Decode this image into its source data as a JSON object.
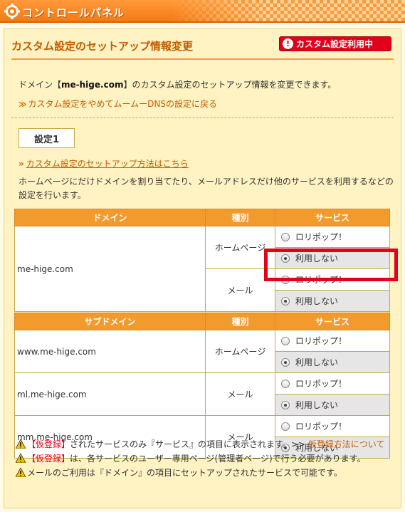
{
  "header": {
    "title": "コントロールパネル",
    "icon": "gear-icon"
  },
  "panel": {
    "title": "カスタム設定のセットアップ情報変更",
    "badge": "カスタム設定利用中",
    "badge_icon": "exclamation-icon",
    "description_prefix": "ドメイン【",
    "domain": "me-hige.com",
    "description_suffix": "】のカスタム設定のセットアップ情報を変更できます。",
    "back_link": "カスタム設定をやめてムームーDNSの設定に戻る",
    "setting_label": "設定1",
    "howto_link": "カスタム設定のセットアップ方法はこちら",
    "explain": "ホームページにだけドメインを割り当てたり、メールアドレスだけ他のサービスを利用するなどの設定を行います。"
  },
  "table1": {
    "headers": [
      "ドメイン",
      "種別",
      "サービス"
    ],
    "domain": "me-hige.com",
    "rows": [
      {
        "type": "ホームページ",
        "opt1": "ロリポップ！",
        "opt2": "利用しない"
      },
      {
        "type": "メール",
        "opt1": "ロリポップ！",
        "opt2": "利用しない"
      }
    ]
  },
  "table2": {
    "headers": [
      "サブドメイン",
      "種別",
      "サービス"
    ],
    "rows": [
      {
        "domain": "www.me-hige.com",
        "type": "ホームページ",
        "opt1": "ロリポップ！",
        "opt2": "利用しない"
      },
      {
        "domain": "ml.me-hige.com",
        "type": "メール",
        "opt1": "ロリポップ！",
        "opt2": "利用しない"
      },
      {
        "domain": "mm.me-hige.com",
        "type": "メール",
        "opt1": "ロリポップ！",
        "opt2": "利用しない"
      }
    ]
  },
  "notes": {
    "n1_red": "【仮登録】",
    "n1_text": "されたサービスのみ『サービス』の項目に表示されます。>>",
    "n1_link": "仮登録方法について",
    "n2_red": "【仮登録】",
    "n2_text": "は、各サービスのユーザー専用ページ(管理者ページ)で行う必要があります。",
    "n3_text": "メールのご利用は『ドメイン』の項目にセットアップされたサービスで可能です。"
  },
  "colors": {
    "accent": "#f39a2c",
    "highlight": "#e3001b",
    "panel_bg": "#fff3c4"
  }
}
